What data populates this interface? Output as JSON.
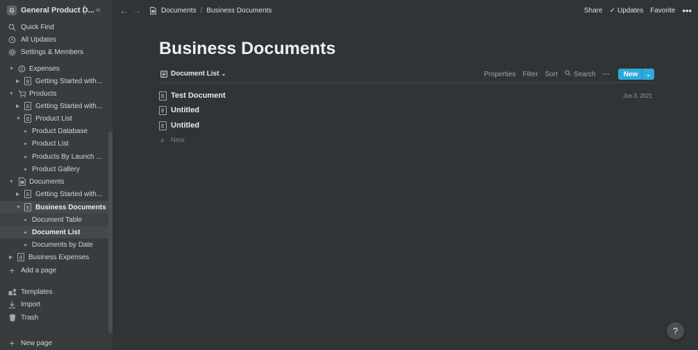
{
  "workspace": {
    "name": "General Product D...",
    "logo_letter": "G"
  },
  "sidebar": {
    "quick": [
      {
        "label": "Quick Find",
        "icon": "search-icon"
      },
      {
        "label": "All Updates",
        "icon": "clock-icon"
      },
      {
        "label": "Settings & Members",
        "icon": "gear-icon"
      }
    ],
    "tree": [
      {
        "label": "Expenses",
        "icon": "money-icon"
      },
      {
        "label": "Getting Started with...",
        "icon": "page-icon"
      },
      {
        "label": "Products",
        "icon": "cart-icon"
      },
      {
        "label": "Getting Started with...",
        "icon": "page-icon"
      },
      {
        "label": "Product List",
        "icon": "page-icon"
      },
      {
        "label": "Product Database"
      },
      {
        "label": "Product List"
      },
      {
        "label": "Products By Launch ..."
      },
      {
        "label": "Product Gallery"
      },
      {
        "label": "Documents",
        "icon": "document-icon"
      },
      {
        "label": "Getting Started with...",
        "icon": "page-icon"
      },
      {
        "label": "Business Documents",
        "icon": "page-icon"
      },
      {
        "label": "Document Table"
      },
      {
        "label": "Document List"
      },
      {
        "label": "Documents by Date"
      },
      {
        "label": "Business Expenses",
        "icon": "page-icon"
      }
    ],
    "add_page": "Add a page",
    "bottom": [
      {
        "label": "Templates",
        "icon": "templates-icon"
      },
      {
        "label": "Import",
        "icon": "import-icon"
      },
      {
        "label": "Trash",
        "icon": "trash-icon"
      }
    ],
    "new_page": "New page"
  },
  "topbar": {
    "breadcrumb": [
      "Documents",
      "Business Documents"
    ],
    "share": "Share",
    "updates": "Updates",
    "favorite": "Favorite"
  },
  "page": {
    "title": "Business Documents",
    "view_name": "Document List",
    "toolbar": {
      "properties": "Properties",
      "filter": "Filter",
      "sort": "Sort",
      "search": "Search",
      "new": "New"
    },
    "items": [
      {
        "name": "Test Document",
        "date": "Jun 3, 2021"
      },
      {
        "name": "Untitled",
        "date": ""
      },
      {
        "name": "Untitled",
        "date": ""
      }
    ],
    "new_label": "New"
  },
  "help": "?"
}
